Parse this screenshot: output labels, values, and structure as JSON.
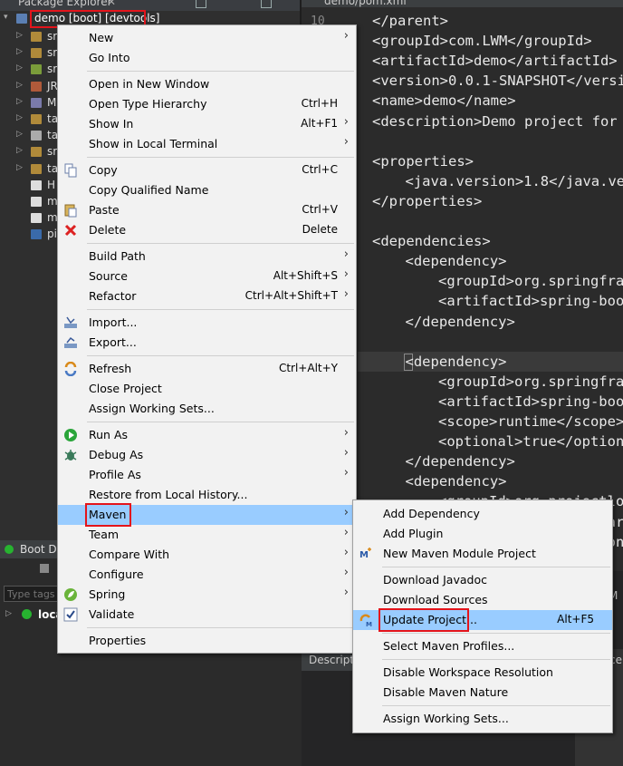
{
  "package_explorer": {
    "title": "Package Explorer",
    "close": "✕",
    "root": "demo [boot] [devtools]",
    "items": [
      {
        "label": "sr",
        "color": "#b08a3a"
      },
      {
        "label": "sr",
        "color": "#b08a3a"
      },
      {
        "label": "sr",
        "color": "#7a9c3a"
      },
      {
        "label": "JR",
        "color": "#b05a3a"
      },
      {
        "label": "M",
        "color": "#7a7aaa"
      },
      {
        "label": "ta",
        "color": "#b08a3a"
      },
      {
        "label": "ta",
        "color": "#aaa"
      },
      {
        "label": "sr",
        "color": "#b08a3a"
      },
      {
        "label": "ta",
        "color": "#b08a3a"
      },
      {
        "label": "H",
        "color": "#ddd"
      },
      {
        "label": "m",
        "color": "#ddd"
      },
      {
        "label": "m",
        "color": "#ddd"
      },
      {
        "label": "pi",
        "color": "#3a6aaa"
      }
    ]
  },
  "boot_dashboard": {
    "tab": "Boot Da",
    "tags_placeholder": "Type tags,",
    "local": "loca"
  },
  "editor": {
    "tab": "demo/pom.xml",
    "line_number": "10",
    "lines": [
      {
        "indent": 0,
        "text": "</parent>"
      },
      {
        "indent": 0,
        "text": "<groupId>com.LWM</groupId>"
      },
      {
        "indent": 0,
        "text": "<artifactId>demo</artifactId>"
      },
      {
        "indent": 0,
        "text": "<version>0.0.1-SNAPSHOT</versio"
      },
      {
        "indent": 0,
        "text": "<name>demo</name>"
      },
      {
        "indent": 0,
        "text": "<description>Demo project for S"
      },
      {
        "indent": 0,
        "text": ""
      },
      {
        "indent": 0,
        "text": "<properties>"
      },
      {
        "indent": 1,
        "text": "<java.version>1.8</java.ve"
      },
      {
        "indent": 0,
        "text": "</properties>"
      },
      {
        "indent": 0,
        "text": ""
      },
      {
        "indent": 0,
        "text": "<dependencies>"
      },
      {
        "indent": 1,
        "text": "<dependency>"
      },
      {
        "indent": 2,
        "text": "<groupId>org.springfram"
      },
      {
        "indent": 2,
        "text": "<artifactId>spring-boot"
      },
      {
        "indent": 1,
        "text": "</dependency>"
      },
      {
        "indent": 0,
        "text": ""
      },
      {
        "indent": 1,
        "text": "<dependency>"
      },
      {
        "indent": 2,
        "text": "<groupId>org.springfram"
      },
      {
        "indent": 2,
        "text": "<artifactId>spring-boot"
      },
      {
        "indent": 2,
        "text": "<scope>runtime</scope>"
      },
      {
        "indent": 2,
        "text": "<optional>true</optiona"
      },
      {
        "indent": 1,
        "text": "</dependency>"
      },
      {
        "indent": 1,
        "text": "<dependency>"
      },
      {
        "indent": 2,
        "text": "<groupId>org.projectlom"
      },
      {
        "indent": 2,
        "text": "<artifactId>lombok</art"
      },
      {
        "indent": 2,
        "text": "<optional>true</optiona"
      }
    ]
  },
  "lower_panel": {
    "tab": "Descriptio",
    "right_tab": "ce",
    "m_label": "M"
  },
  "context_menu": {
    "items": [
      {
        "label": "New",
        "shortcut": "",
        "submenu": true,
        "icon": ""
      },
      {
        "label": "Go Into",
        "shortcut": "",
        "submenu": false,
        "icon": ""
      },
      {
        "sep": true
      },
      {
        "label": "Open in New Window",
        "shortcut": "",
        "submenu": false,
        "icon": ""
      },
      {
        "label": "Open Type Hierarchy",
        "shortcut": "Ctrl+H",
        "submenu": false,
        "icon": ""
      },
      {
        "label": "Show In",
        "shortcut": "Alt+F1",
        "submenu": true,
        "icon": ""
      },
      {
        "label": "Show in Local Terminal",
        "shortcut": "",
        "submenu": true,
        "icon": ""
      },
      {
        "sep": true
      },
      {
        "label": "Copy",
        "shortcut": "Ctrl+C",
        "submenu": false,
        "icon": "copy-icon"
      },
      {
        "label": "Copy Qualified Name",
        "shortcut": "",
        "submenu": false,
        "icon": ""
      },
      {
        "label": "Paste",
        "shortcut": "Ctrl+V",
        "submenu": false,
        "icon": "paste-icon"
      },
      {
        "label": "Delete",
        "shortcut": "Delete",
        "submenu": false,
        "icon": "delete-icon"
      },
      {
        "sep": true
      },
      {
        "label": "Build Path",
        "shortcut": "",
        "submenu": true,
        "icon": ""
      },
      {
        "label": "Source",
        "shortcut": "Alt+Shift+S",
        "submenu": true,
        "icon": ""
      },
      {
        "label": "Refactor",
        "shortcut": "Ctrl+Alt+Shift+T",
        "submenu": true,
        "icon": ""
      },
      {
        "sep": true
      },
      {
        "label": "Import...",
        "shortcut": "",
        "submenu": false,
        "icon": "import-icon"
      },
      {
        "label": "Export...",
        "shortcut": "",
        "submenu": false,
        "icon": "export-icon"
      },
      {
        "sep": true
      },
      {
        "label": "Refresh",
        "shortcut": "Ctrl+Alt+Y",
        "submenu": false,
        "icon": "refresh-icon"
      },
      {
        "label": "Close Project",
        "shortcut": "",
        "submenu": false,
        "icon": ""
      },
      {
        "label": "Assign Working Sets...",
        "shortcut": "",
        "submenu": false,
        "icon": ""
      },
      {
        "sep": true
      },
      {
        "label": "Run As",
        "shortcut": "",
        "submenu": true,
        "icon": "run-icon"
      },
      {
        "label": "Debug As",
        "shortcut": "",
        "submenu": true,
        "icon": "debug-icon"
      },
      {
        "label": "Profile As",
        "shortcut": "",
        "submenu": true,
        "icon": ""
      },
      {
        "label": "Restore from Local History...",
        "shortcut": "",
        "submenu": false,
        "icon": ""
      },
      {
        "label": "Maven",
        "shortcut": "",
        "submenu": true,
        "icon": "",
        "highlight": true
      },
      {
        "label": "Team",
        "shortcut": "",
        "submenu": true,
        "icon": ""
      },
      {
        "label": "Compare With",
        "shortcut": "",
        "submenu": true,
        "icon": ""
      },
      {
        "label": "Configure",
        "shortcut": "",
        "submenu": true,
        "icon": ""
      },
      {
        "label": "Spring",
        "shortcut": "",
        "submenu": true,
        "icon": "spring-icon"
      },
      {
        "label": "Validate",
        "shortcut": "",
        "submenu": false,
        "icon": "check-icon"
      },
      {
        "sep": true
      },
      {
        "label": "Properties",
        "shortcut": "",
        "submenu": false,
        "icon": ""
      }
    ]
  },
  "maven_menu": {
    "items": [
      {
        "label": "Add Dependency",
        "shortcut": "",
        "icon": ""
      },
      {
        "label": "Add Plugin",
        "shortcut": "",
        "icon": ""
      },
      {
        "label": "New Maven Module Project",
        "shortcut": "",
        "icon": "maven-module-icon"
      },
      {
        "sep": true
      },
      {
        "label": "Download Javadoc",
        "shortcut": "",
        "icon": ""
      },
      {
        "label": "Download Sources",
        "shortcut": "",
        "icon": ""
      },
      {
        "label": "Update Project...",
        "shortcut": "Alt+F5",
        "icon": "update-project-icon",
        "highlight": true
      },
      {
        "sep": true
      },
      {
        "label": "Select Maven Profiles...",
        "shortcut": "",
        "icon": ""
      },
      {
        "sep": true
      },
      {
        "label": "Disable Workspace Resolution",
        "shortcut": "",
        "icon": ""
      },
      {
        "label": "Disable Maven Nature",
        "shortcut": "",
        "icon": ""
      },
      {
        "sep": true
      },
      {
        "label": "Assign Working Sets...",
        "shortcut": "",
        "icon": ""
      }
    ]
  },
  "colors": {
    "highlight": "#99ccff",
    "annotation": "#e4141b",
    "tag": "#e8e8e8"
  }
}
